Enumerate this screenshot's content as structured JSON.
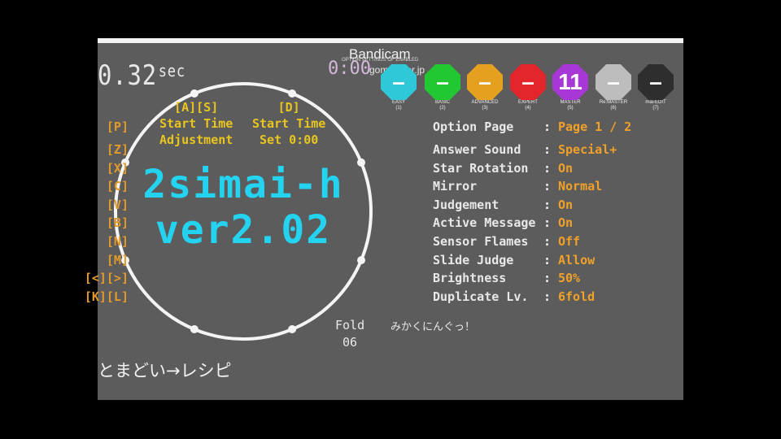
{
  "timer": {
    "value": "0.32",
    "unit": "sec"
  },
  "counter": "0:00",
  "watermark": {
    "brand": "Bandicam",
    "sub": "OPTION  SETTINGS OF ENABLED",
    "site": "gomplayer.jp"
  },
  "hints": {
    "left": {
      "keys": "[A][S]",
      "line1": "Start Time",
      "line2": "Adjustment"
    },
    "right": {
      "keys": "[D]",
      "line1": "Start Time",
      "line2": "Set 0:00"
    }
  },
  "title": {
    "line1": "2simai-h",
    "line2": "ver2.02"
  },
  "difficulties": [
    {
      "value": "–",
      "label": "EASY",
      "key": "(1)",
      "color": "#2ec8d8"
    },
    {
      "value": "–",
      "label": "BASIC",
      "key": "(2)",
      "color": "#22c832"
    },
    {
      "value": "–",
      "label": "ADVANCED",
      "key": "(3)",
      "color": "#e6a020"
    },
    {
      "value": "–",
      "label": "EXPERT",
      "key": "(4)",
      "color": "#e2262c"
    },
    {
      "value": "11",
      "label": "MASTER",
      "key": "(5)",
      "color": "#a838d6"
    },
    {
      "value": "–",
      "label": "Re:MASTER",
      "key": "(6)",
      "color": "#bdbdbd"
    },
    {
      "value": "–",
      "label": "mai-EDIT",
      "key": "(7)",
      "color": "#2e2e2e"
    }
  ],
  "options": [
    {
      "key": "[P]",
      "name": "Option Page",
      "value": "Page 1 / 2"
    },
    {
      "key": "[Z]",
      "name": "Answer Sound",
      "value": "Special+"
    },
    {
      "key": "[X]",
      "name": "Star Rotation",
      "value": "On"
    },
    {
      "key": "[C]",
      "name": "Mirror",
      "value": "Normal"
    },
    {
      "key": "[V]",
      "name": "Judgement",
      "value": "On"
    },
    {
      "key": "[B]",
      "name": "Active Message",
      "value": "On"
    },
    {
      "key": "[N]",
      "name": "Sensor Flames",
      "value": "Off"
    },
    {
      "key": "[M]",
      "name": "Slide Judge",
      "value": "Allow"
    },
    {
      "key": "[<][>]",
      "name": "Brightness",
      "value": "50%"
    },
    {
      "key": "[K][L]",
      "name": "Duplicate Lv.",
      "value": "6fold"
    }
  ],
  "option_colon": ":",
  "fold": {
    "label": "Fold",
    "value": "06"
  },
  "song": "みかくにんぐっ！",
  "lyric": "とまどい→レシピ"
}
